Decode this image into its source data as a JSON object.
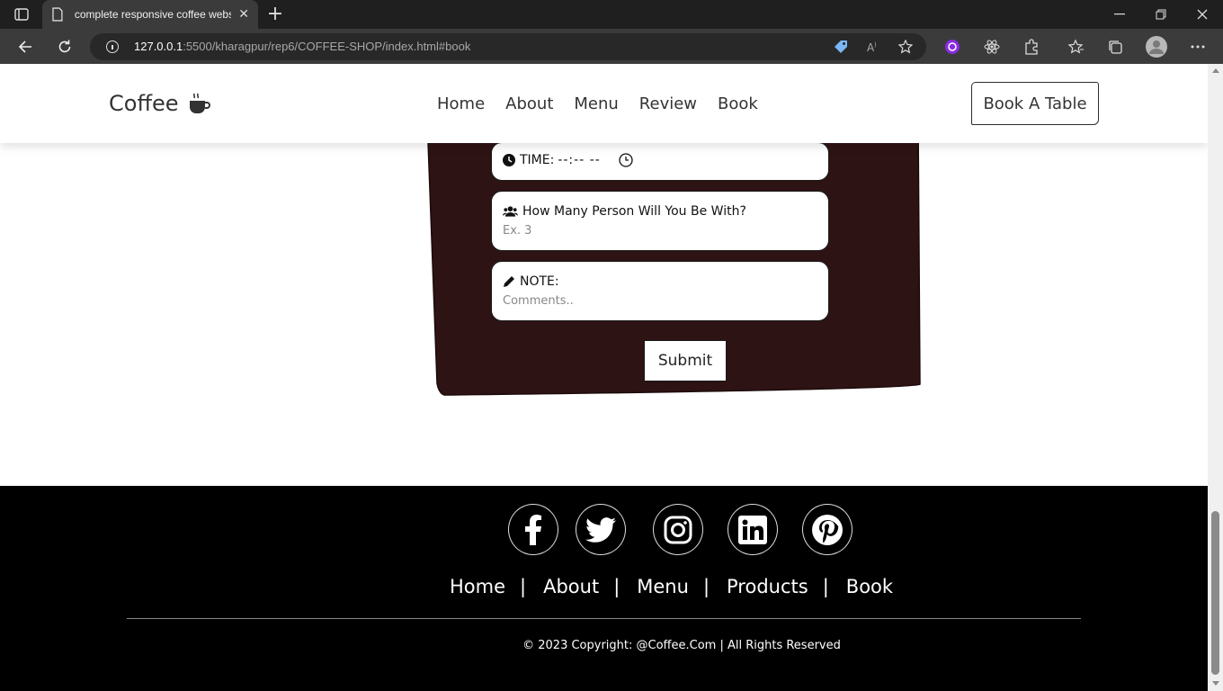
{
  "browser": {
    "tab_title": "complete responsive coffee webs",
    "url_host": "127.0.0.1",
    "url_rest": ":5500/kharagpur/rep6/COFFEE-SHOP/index.html#book"
  },
  "header": {
    "logo_text": "Coffee",
    "nav": [
      "Home",
      "About",
      "Menu",
      "Review",
      "Book"
    ],
    "cta_label": "Book A Table"
  },
  "form": {
    "time_label": "TIME:",
    "time_value": "--:-- --",
    "persons_label": "How Many Person Will You Be With?",
    "persons_placeholder": "Ex. 3",
    "note_label": "NOTE:",
    "note_placeholder": "Comments..",
    "submit_label": "Submit"
  },
  "footer": {
    "socials": [
      "facebook-icon",
      "twitter-icon",
      "instagram-icon",
      "linkedin-icon",
      "pinterest-icon"
    ],
    "links": [
      "Home",
      "About",
      "Menu",
      "Products",
      "Book"
    ],
    "copyright": "© 2023 Copyright: @Coffee.Com | All Rights Reserved"
  },
  "colors": {
    "form_bg": "#2e1314",
    "footer_bg": "#000000",
    "chrome_dark": "#1f1f1f",
    "chrome_mid": "#3b3b3b"
  }
}
